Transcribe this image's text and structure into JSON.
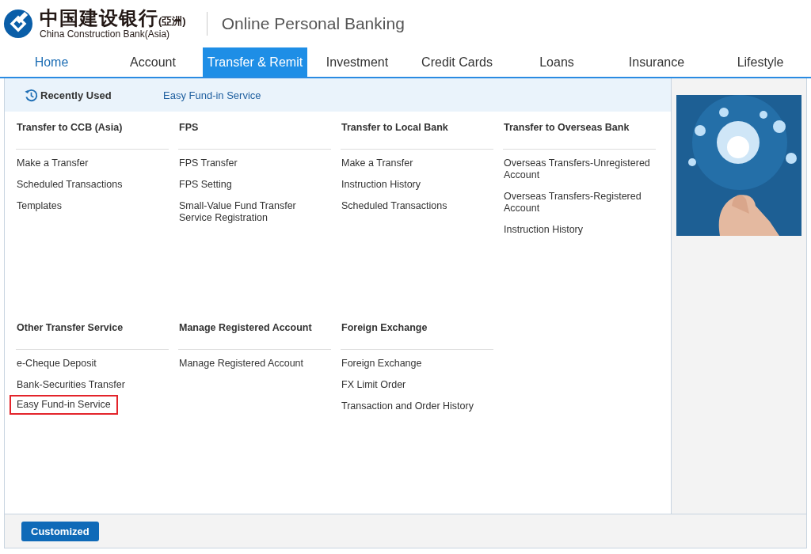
{
  "brand": {
    "name_cn": "中国建设银行",
    "region_cn": "(亞洲)",
    "name_en": "China Construction Bank(Asia)",
    "product": "Online Personal Banking"
  },
  "nav": [
    {
      "label": "Home",
      "selected": false
    },
    {
      "label": "Account",
      "selected": false
    },
    {
      "label": "Transfer & Remit",
      "selected": true
    },
    {
      "label": "Investment",
      "selected": false
    },
    {
      "label": "Credit Cards",
      "selected": false
    },
    {
      "label": "Loans",
      "selected": false
    },
    {
      "label": "Insurance",
      "selected": false
    },
    {
      "label": "Lifestyle",
      "selected": false
    }
  ],
  "recently_used": {
    "label": "Recently Used",
    "links": [
      "Easy Fund-in Service"
    ]
  },
  "section_rows": [
    [
      {
        "title": "Transfer to CCB (Asia)",
        "items": [
          {
            "label": "Make a Transfer",
            "highlighted": false
          },
          {
            "label": "Scheduled Transactions",
            "highlighted": false
          },
          {
            "label": "Templates",
            "highlighted": false
          }
        ]
      },
      {
        "title": "FPS",
        "items": [
          {
            "label": "FPS Transfer",
            "highlighted": false
          },
          {
            "label": "FPS Setting",
            "highlighted": false
          },
          {
            "label": "Small-Value Fund Transfer Service Registration",
            "highlighted": false
          }
        ]
      },
      {
        "title": "Transfer to Local Bank",
        "items": [
          {
            "label": "Make a Transfer",
            "highlighted": false
          },
          {
            "label": "Instruction History",
            "highlighted": false
          },
          {
            "label": "Scheduled Transactions",
            "highlighted": false
          }
        ]
      },
      {
        "title": "Transfer to Overseas Bank",
        "items": [
          {
            "label": "Overseas Transfers-Unregistered Account",
            "highlighted": false
          },
          {
            "label": "Overseas Transfers-Registered Account",
            "highlighted": false
          },
          {
            "label": "Instruction History",
            "highlighted": false
          }
        ]
      }
    ],
    [
      {
        "title": "Other Transfer Service",
        "items": [
          {
            "label": "e-Cheque Deposit",
            "highlighted": false
          },
          {
            "label": "Bank-Securities Transfer",
            "highlighted": false
          },
          {
            "label": "Easy Fund-in Service",
            "highlighted": true
          }
        ]
      },
      {
        "title": "Manage Registered Account",
        "items": [
          {
            "label": "Manage Registered Account",
            "highlighted": false
          }
        ]
      },
      {
        "title": "Foreign Exchange",
        "items": [
          {
            "label": "Foreign Exchange",
            "highlighted": false
          },
          {
            "label": "FX Limit Order",
            "highlighted": false
          },
          {
            "label": "Transaction and Order History",
            "highlighted": false
          }
        ]
      }
    ]
  ],
  "aside": {
    "kind": "picture"
  },
  "footer_button": "Customized"
}
